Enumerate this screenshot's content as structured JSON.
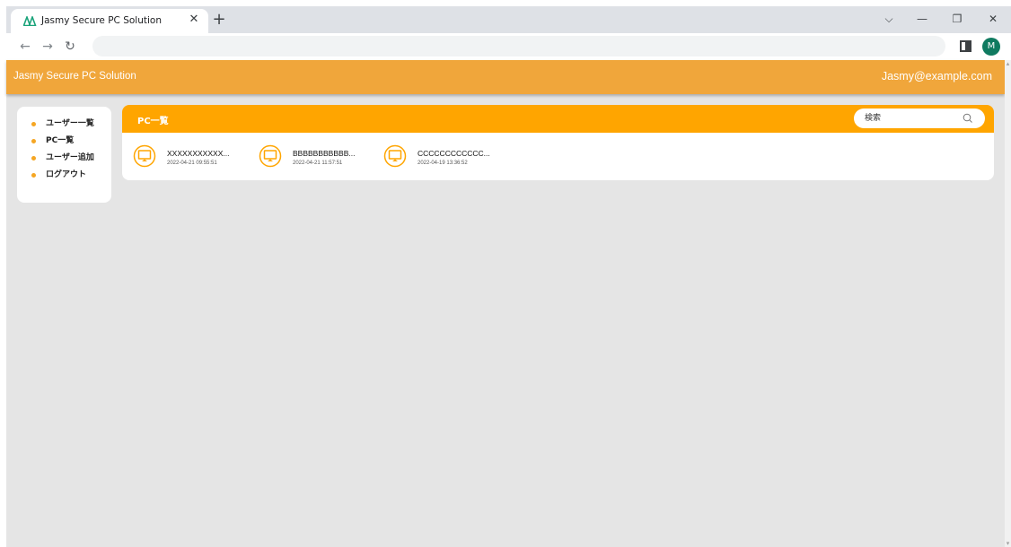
{
  "browser": {
    "tab_title": "Jasmy Secure PC Solution",
    "tab_close": "✕",
    "new_tab": "+",
    "profile_initial": "M",
    "controls": {
      "dropdown": "⌵",
      "minimize": "—",
      "restore": "❐",
      "close": "✕"
    },
    "nav": {
      "back": "←",
      "forward": "→",
      "reload": "↻"
    }
  },
  "app": {
    "title": "Jasmy Secure PC Solution",
    "user_email": "Jasmy@example.com",
    "accent_color": "#f0a63b",
    "panel_color": "#ffa500"
  },
  "sidebar": {
    "items": [
      {
        "label": "ユーザー一覧"
      },
      {
        "label": "PC一覧"
      },
      {
        "label": "ユーザー追加"
      },
      {
        "label": "ログアウト"
      }
    ]
  },
  "panel": {
    "title": "PC一覧",
    "search_placeholder": "検索",
    "pcs": [
      {
        "name": "XXXXXXXXXXX...",
        "date": "2022-04-21 09:55:51",
        "icon": "monitor-icon"
      },
      {
        "name": "BBBBBBBBBBB...",
        "date": "2022-04-21 11:57:51",
        "icon": "monitor-icon"
      },
      {
        "name": "CCCCCCCCCCCC...",
        "date": "2022-04-19 13:36:52",
        "icon": "monitor-icon"
      }
    ]
  }
}
